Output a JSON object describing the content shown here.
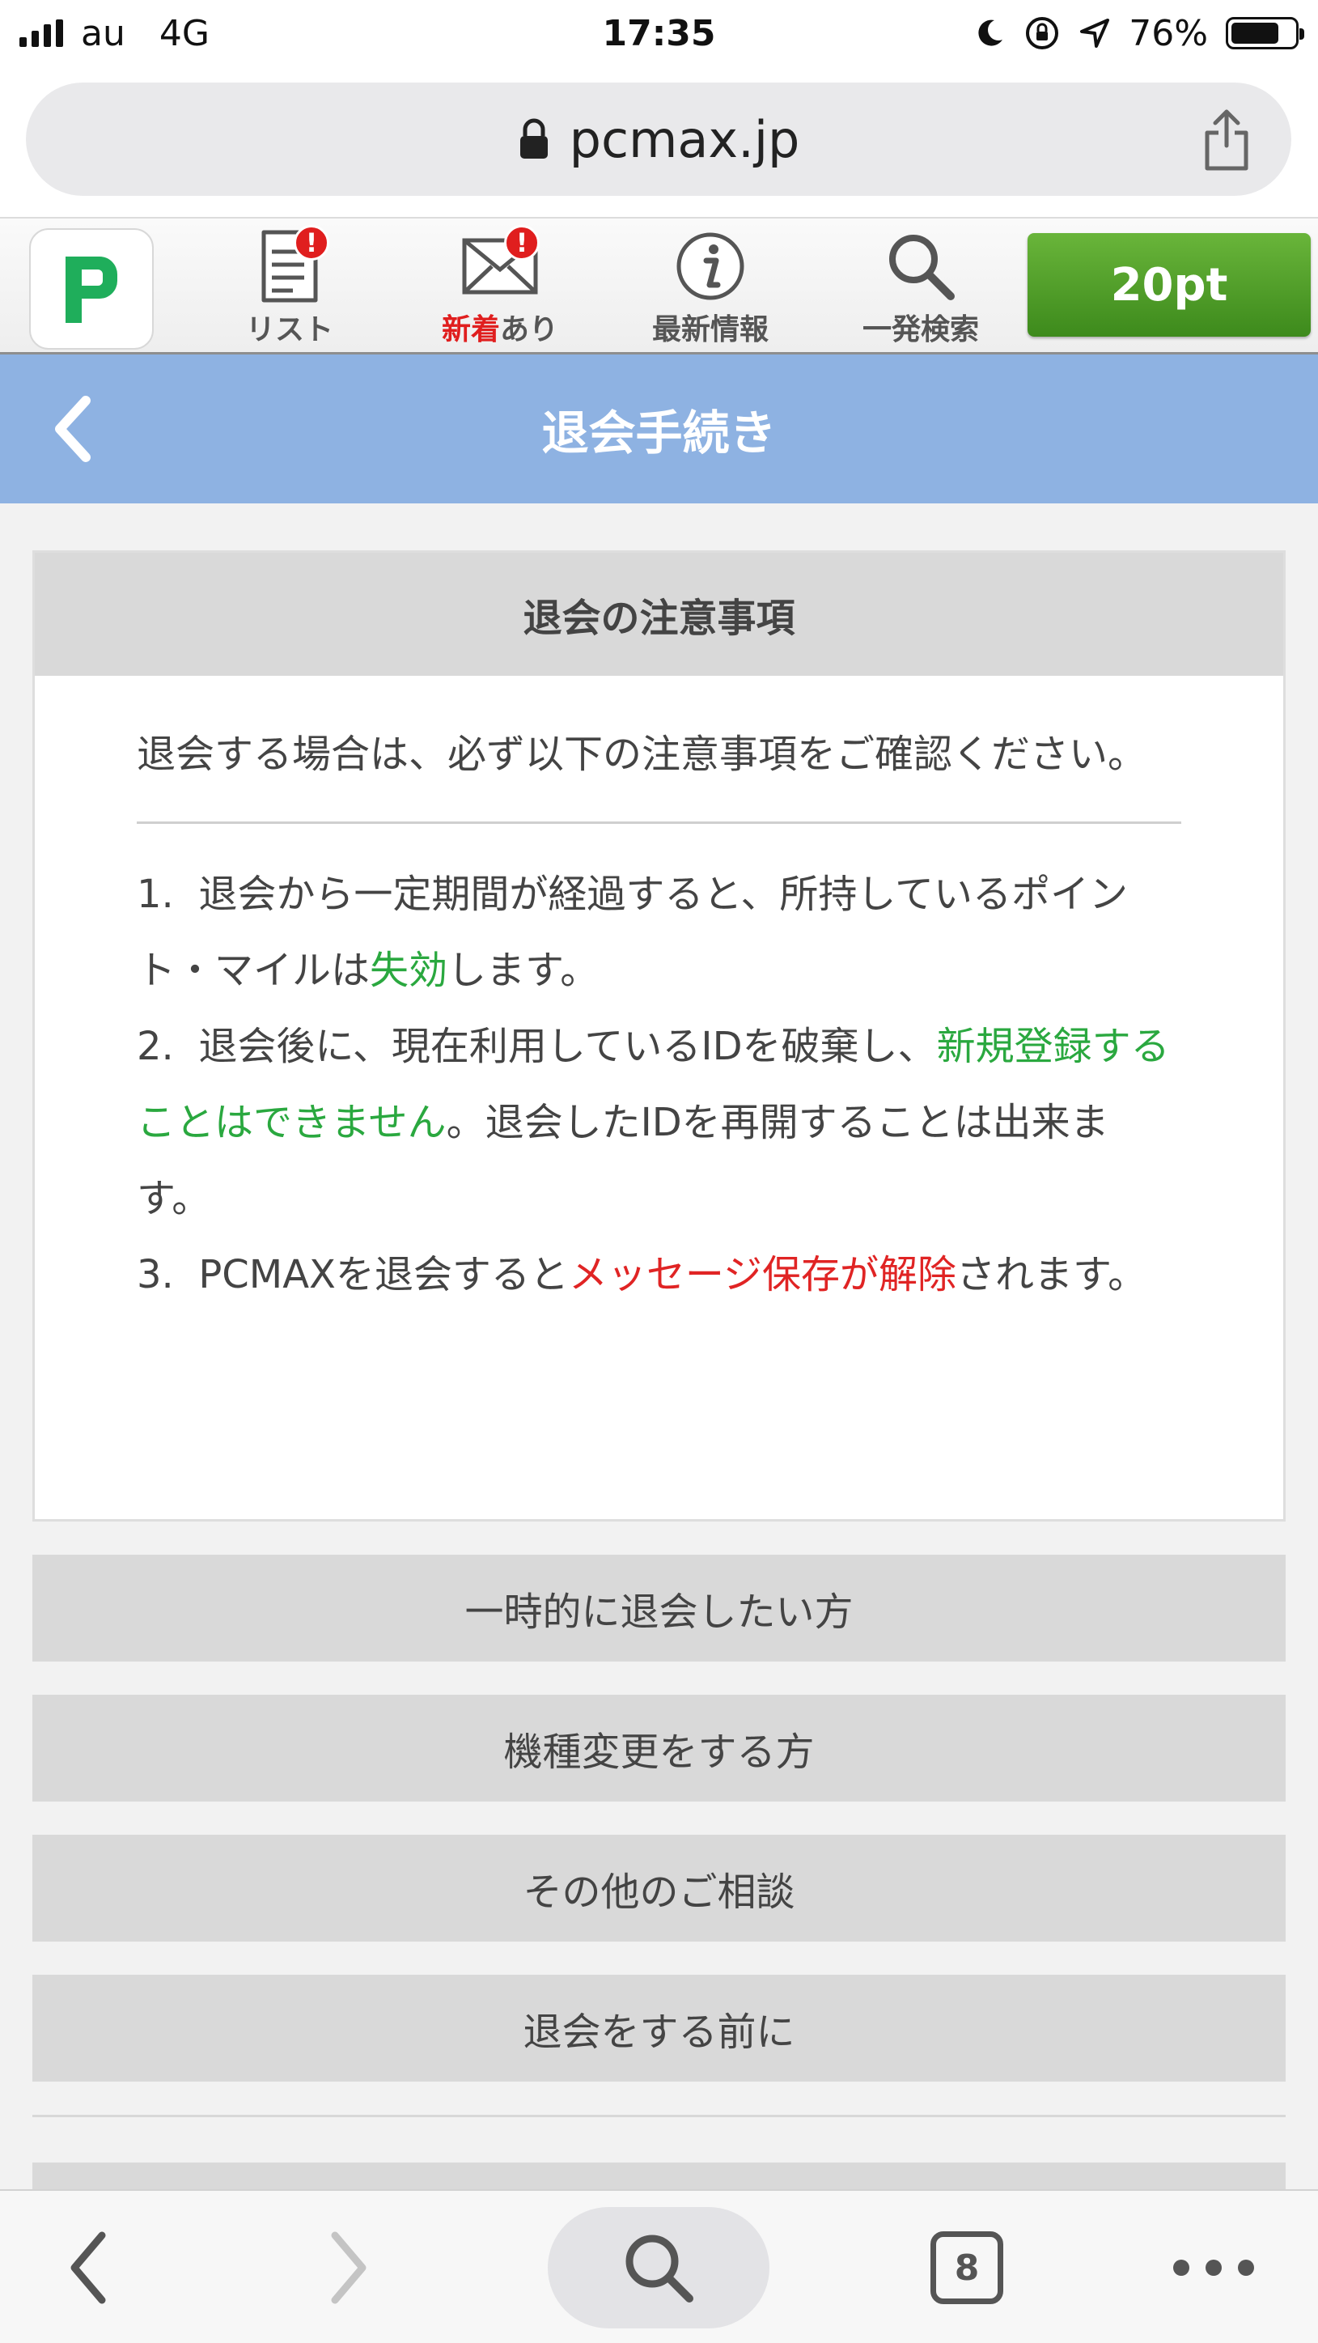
{
  "status_bar": {
    "carrier": "au",
    "network": "4G",
    "time": "17:35",
    "battery": "76%",
    "battery_level": 0.76
  },
  "browser": {
    "url": "pcmax.jp",
    "tab_count": "8"
  },
  "app_nav": {
    "list_label": "リスト",
    "list_badge": "!",
    "new_mail_label_red": "新着",
    "new_mail_label_rest": "あり",
    "new_mail_badge": "!",
    "info_label": "最新情報",
    "search_label": "一発検索",
    "points": "20pt"
  },
  "header": {
    "title": "退会手続き"
  },
  "notice": {
    "heading": "退会の注意事項",
    "intro": "退会する場合は、必ず以下の注意事項をご確認ください。",
    "items": [
      {
        "num": "1.",
        "pre": "退会から一定期間が経過すると、所持しているポイント・マイルは",
        "highlight": "失効",
        "post": "します。"
      },
      {
        "num": "2.",
        "pre": "退会後に、現在利用しているIDを破棄し、",
        "highlight": "新規登録することはできません",
        "post": "。退会したIDを再開することは出来ます。"
      },
      {
        "num": "3.",
        "pre": "PCMAXを退会すると",
        "highlight": "メッセージ保存が解除",
        "post": "されます。"
      }
    ]
  },
  "menu": [
    {
      "label": "一時的に退会したい方"
    },
    {
      "label": "機種変更をする方"
    },
    {
      "label": "その他のご相談"
    },
    {
      "label": "退会をする前に"
    }
  ],
  "colors": {
    "header_bg": "#8eb2e2",
    "points_green": "#4a9a26",
    "highlight_green": "#2aa83f",
    "highlight_red": "#e02424",
    "badge_red": "#e01e1e",
    "logo_green": "#1fae5b"
  }
}
